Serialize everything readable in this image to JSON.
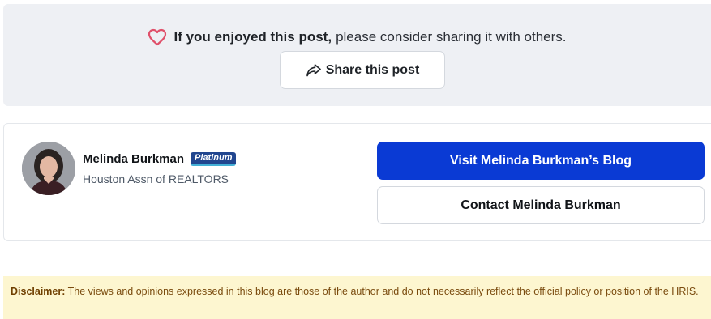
{
  "share": {
    "lead_bold": "If you enjoyed this post,",
    "lead_rest": "please consider sharing it with others.",
    "button_label": "Share this post"
  },
  "author": {
    "name": "Melinda Burkman",
    "badge": "Platinum",
    "organization": "Houston Assn of REALTORS",
    "visit_label": "Visit Melinda Burkman’s Blog",
    "contact_label": "Contact Melinda Burkman"
  },
  "disclaimer": {
    "label": "Disclaimer:",
    "text": "The views and opinions expressed in this blog are those of the author and do not necessarily reflect the official policy or position of the HRIS."
  },
  "colors": {
    "heart": "#e0506a",
    "primary_button": "#0a3ad4",
    "badge": "#21468f",
    "disclaimer_bg": "#fdf6d0"
  }
}
